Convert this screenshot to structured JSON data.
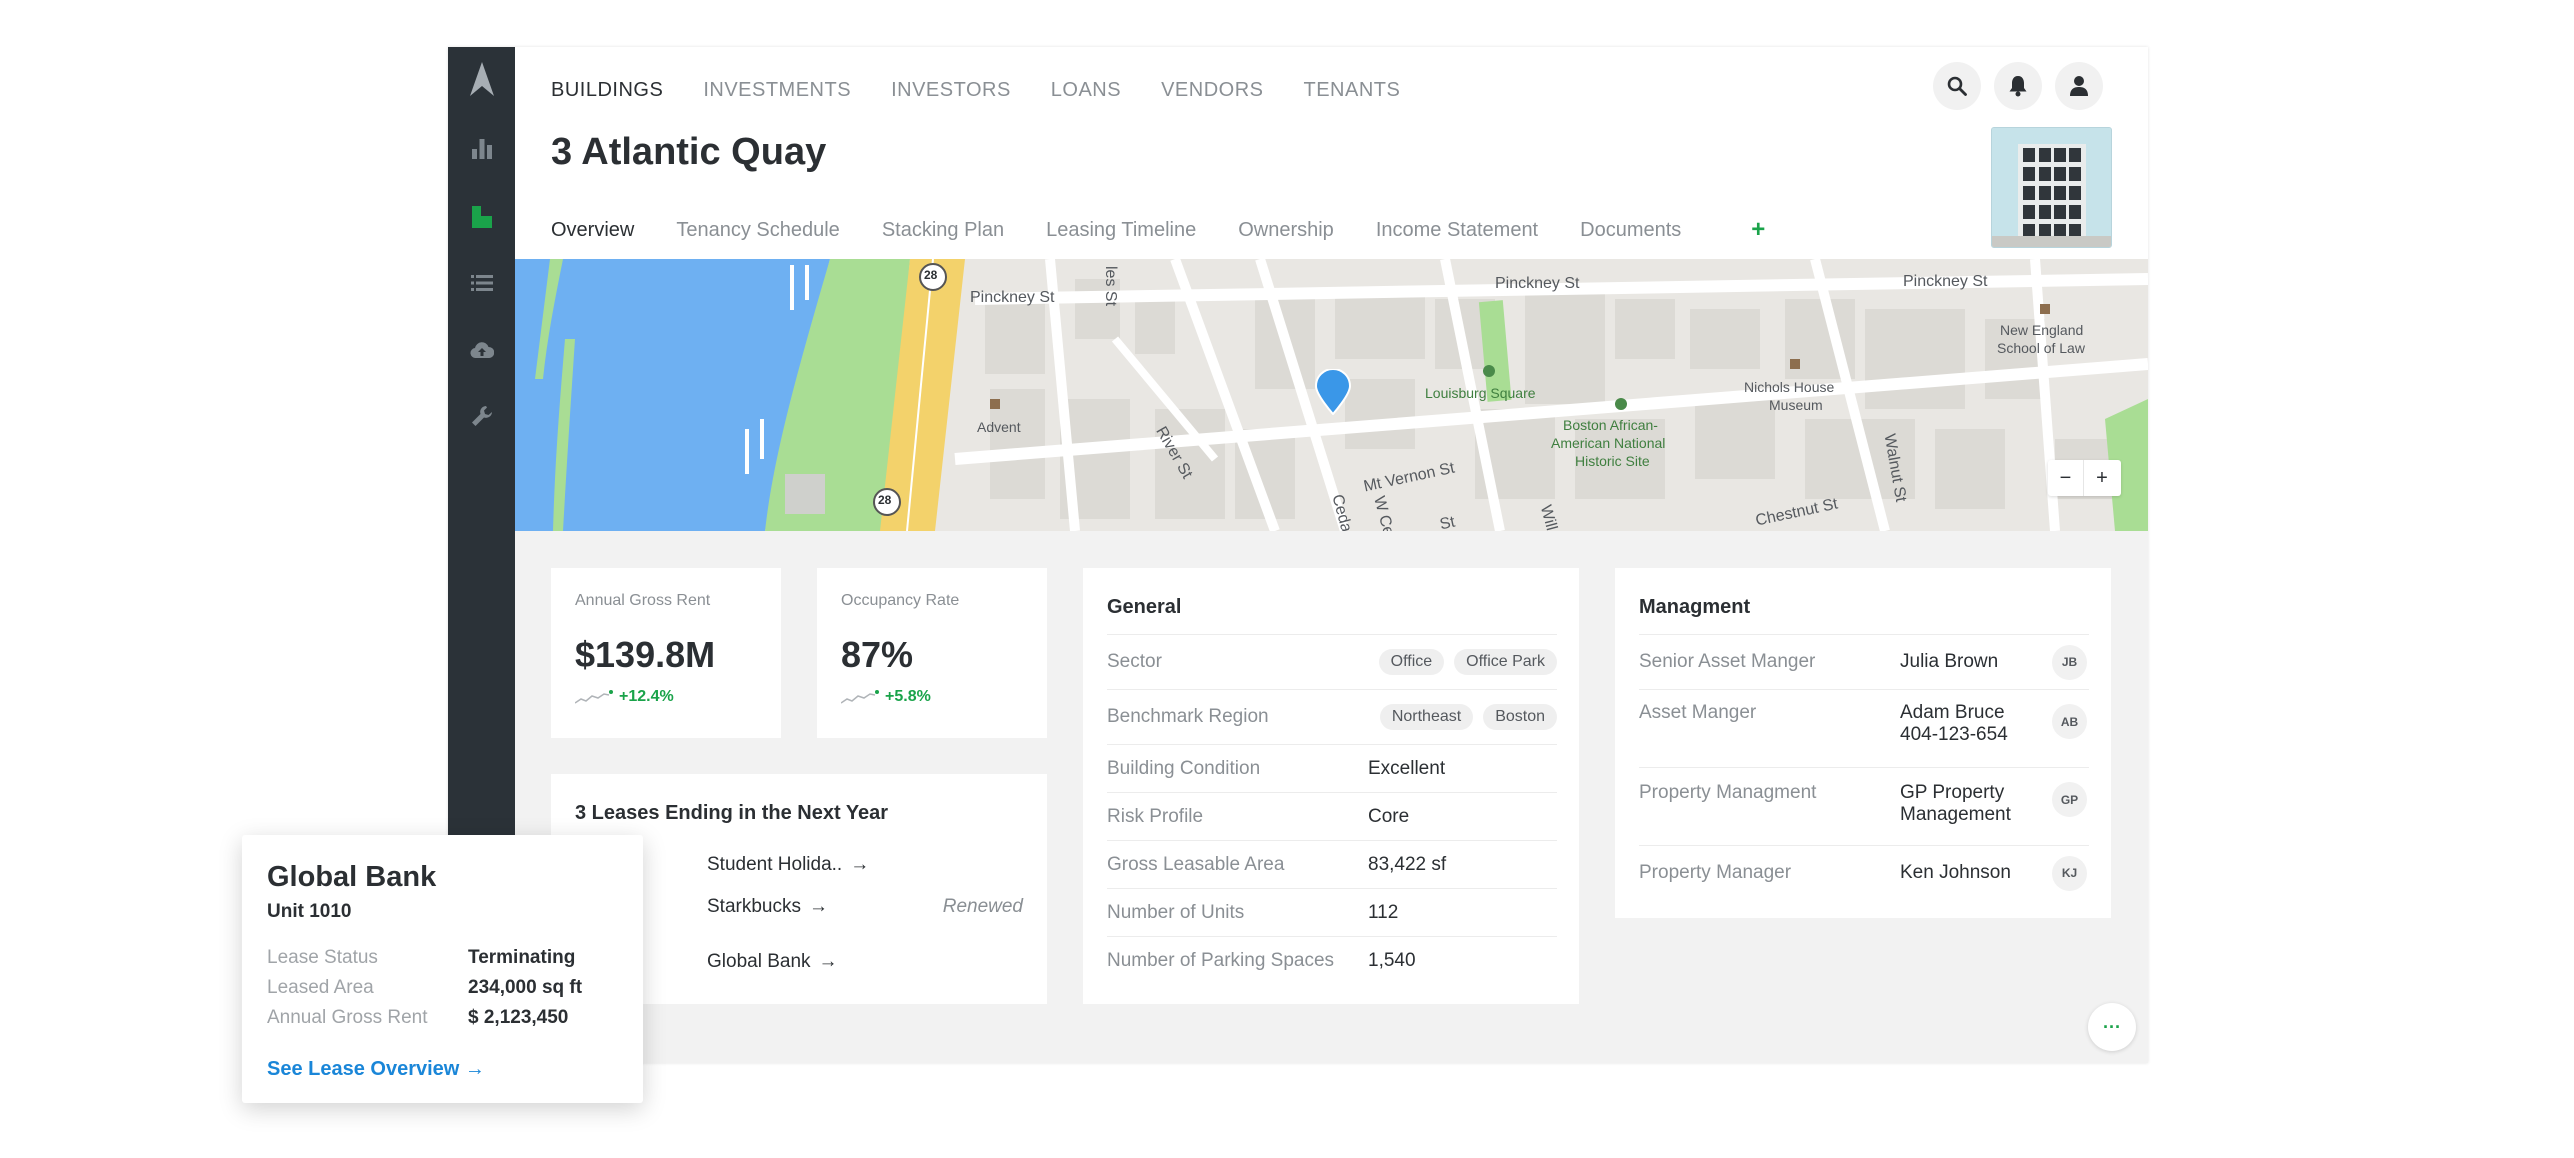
{
  "topnav": {
    "items": [
      "BUILDINGS",
      "INVESTMENTS",
      "INVESTORS",
      "LOANS",
      "VENDORS",
      "TENANTS"
    ],
    "active": "BUILDINGS"
  },
  "building": {
    "title": "3 Atlantic Quay"
  },
  "tabs": {
    "items": [
      "Overview",
      "Tenancy Schedule",
      "Stacking Plan",
      "Leasing Timeline",
      "Ownership",
      "Income Statement",
      "Documents"
    ],
    "add_label": "+"
  },
  "map": {
    "labels": {
      "pinckney_1": "Pinckney St",
      "pinckney_2": "Pinckney St",
      "pinckney_3": "Pinckney St",
      "new_england": "New England",
      "school_of_law": "School of Law",
      "louisburg": "Louisburg Square",
      "nichols_1": "Nichols House",
      "nichols_2": "Museum",
      "boston_aa_1": "Boston African-",
      "boston_aa_2": "American National",
      "boston_aa_3": "Historic Site",
      "advent": "Advent",
      "river_st": "River St",
      "mt_vernon": "Mt Vernon St",
      "walnut": "Walnut St",
      "chestnut": "Chestnut St",
      "les_st": "les St",
      "cedar": "Cedar",
      "w_ce": "W Ce",
      "will": "Will",
      "st_frag": "St",
      "route_1": "28",
      "route_2": "28"
    },
    "zoom_out": "−",
    "zoom_in": "+"
  },
  "stats": {
    "gross_rent": {
      "label": "Annual Gross Rent",
      "value": "$139.8M",
      "trend": "+12.4%"
    },
    "occupancy": {
      "label": "Occupancy Rate",
      "value": "87%",
      "trend": "+5.8%"
    }
  },
  "leases": {
    "title": "3 Leases Ending in the Next Year",
    "items": [
      {
        "name": "Student Holida..",
        "status": ""
      },
      {
        "name": "Starkbucks",
        "status": "Renewed"
      },
      {
        "name": "Global Bank",
        "status": ""
      }
    ]
  },
  "general": {
    "title": "General",
    "sector": {
      "label": "Sector",
      "tags": [
        "Office",
        "Office Park"
      ]
    },
    "benchmark": {
      "label": "Benchmark Region",
      "tags": [
        "Northeast",
        "Boston"
      ]
    },
    "rows": [
      {
        "label": "Building Condition",
        "value": "Excellent"
      },
      {
        "label": "Risk Profile",
        "value": "Core"
      },
      {
        "label": "Gross Leasable Area",
        "value": "83,422 sf"
      },
      {
        "label": "Number of Units",
        "value": "112"
      },
      {
        "label": "Number of Parking Spaces",
        "value": "1,540"
      }
    ]
  },
  "management": {
    "title": "Managment",
    "rows": [
      {
        "label": "Senior Asset Manger",
        "value": "Julia Brown",
        "value2": "",
        "initials": "JB"
      },
      {
        "label": "Asset Manger",
        "value": "Adam Bruce",
        "value2": "404-123-654",
        "initials": "AB"
      },
      {
        "label": "Property Managment",
        "value": "GP Property",
        "value2": "Management",
        "initials": "GP"
      },
      {
        "label": "Property Manager",
        "value": "Ken Johnson",
        "value2": "",
        "initials": "KJ"
      }
    ]
  },
  "more_label": "···",
  "popup": {
    "title": "Global Bank",
    "subtitle": "Unit 1010",
    "rows": [
      {
        "label": "Lease Status",
        "value": "Terminating"
      },
      {
        "label": "Leased Area",
        "value": "234,000 sq ft"
      },
      {
        "label": "Annual Gross Rent",
        "value": "$ 2,123,450"
      }
    ],
    "link": "See Lease Overview →"
  },
  "colors": {
    "sidebar": "#2b3238",
    "accent_green": "#1aa34a",
    "link_blue": "#1a86d8",
    "water": "#6eb0f2",
    "park": "#a9dd94",
    "highway": "#f3d26b",
    "marker": "#3a97e8"
  }
}
